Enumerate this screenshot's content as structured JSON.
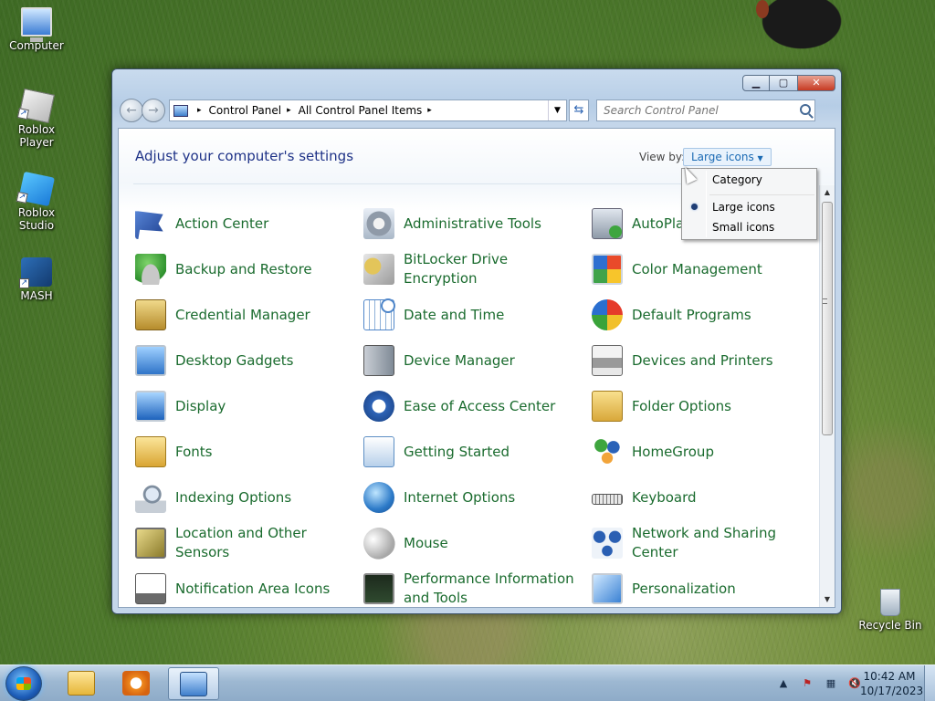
{
  "desktop": {
    "icons": [
      {
        "label": "Computer",
        "icon": "computer-icon"
      },
      {
        "label": "Roblox Player",
        "icon": "roblox-player-icon"
      },
      {
        "label": "Roblox Studio",
        "icon": "roblox-studio-icon"
      },
      {
        "label": "MASH",
        "icon": "mash-icon"
      },
      {
        "label": "Recycle Bin",
        "icon": "recycle-bin-icon"
      }
    ]
  },
  "window": {
    "address": {
      "segments": [
        "Control Panel",
        "All Control Panel Items"
      ],
      "separator": "▸"
    },
    "search_placeholder": "Search Control Panel",
    "heading": "Adjust your computer's settings",
    "view_by_label": "View by:",
    "view_by_value": "Large icons",
    "view_menu": {
      "items": [
        "Category",
        "Large icons",
        "Small icons"
      ],
      "selected": "Large icons"
    },
    "items": [
      {
        "label": "Action Center",
        "icon": "flag-icon",
        "color": "#2b58b3"
      },
      {
        "label": "Administrative Tools",
        "icon": "admin-tools-icon",
        "color": "#7f8a99"
      },
      {
        "label": "AutoPlay",
        "icon": "autoplay-icon",
        "color": "#4a8f3a"
      },
      {
        "label": "Backup and Restore",
        "icon": "backup-icon",
        "color": "#3aa23a"
      },
      {
        "label": "BitLocker Drive Encryption",
        "icon": "bitlocker-icon",
        "color": "#9c9c9c"
      },
      {
        "label": "Color Management",
        "icon": "color-management-icon",
        "color": "#d9452a"
      },
      {
        "label": "Credential Manager",
        "icon": "credential-icon",
        "color": "#c9a646"
      },
      {
        "label": "Date and Time",
        "icon": "calendar-clock-icon",
        "color": "#4f86c9"
      },
      {
        "label": "Default Programs",
        "icon": "default-programs-icon",
        "color": "#d93a2a"
      },
      {
        "label": "Desktop Gadgets",
        "icon": "gadgets-icon",
        "color": "#3c7fd1"
      },
      {
        "label": "Device Manager",
        "icon": "device-manager-icon",
        "color": "#8a96a3"
      },
      {
        "label": "Devices and Printers",
        "icon": "printer-icon",
        "color": "#8c8c8c"
      },
      {
        "label": "Display",
        "icon": "display-icon",
        "color": "#2f78d0"
      },
      {
        "label": "Ease of Access Center",
        "icon": "ease-of-access-icon",
        "color": "#1f4f9c"
      },
      {
        "label": "Folder Options",
        "icon": "folder-options-icon",
        "color": "#e3bd4a"
      },
      {
        "label": "Fonts",
        "icon": "fonts-icon",
        "color": "#e6b83c"
      },
      {
        "label": "Getting Started",
        "icon": "getting-started-icon",
        "color": "#5d8fc4"
      },
      {
        "label": "HomeGroup",
        "icon": "homegroup-icon",
        "color": "#2a62b8"
      },
      {
        "label": "Indexing Options",
        "icon": "indexing-icon",
        "color": "#8c9aa8"
      },
      {
        "label": "Internet Options",
        "icon": "internet-options-icon",
        "color": "#2f7fc9"
      },
      {
        "label": "Keyboard",
        "icon": "keyboard-icon",
        "color": "#8d8d8d"
      },
      {
        "label": "Location and Other Sensors",
        "icon": "location-icon",
        "color": "#b9a44a"
      },
      {
        "label": "Mouse",
        "icon": "mouse-icon",
        "color": "#a8a8a8"
      },
      {
        "label": "Network and Sharing Center",
        "icon": "network-icon",
        "color": "#2a5fb3"
      },
      {
        "label": "Notification Area Icons",
        "icon": "notification-icon",
        "color": "#6a6a6a"
      },
      {
        "label": "Performance Information and Tools",
        "icon": "performance-icon",
        "color": "#3a7a3a"
      },
      {
        "label": "Personalization",
        "icon": "personalization-icon",
        "color": "#3b82d4"
      }
    ]
  },
  "taskbar": {
    "buttons": [
      {
        "name": "windows-explorer",
        "icon": "folder-icon"
      },
      {
        "name": "windows-media-player",
        "icon": "media-player-icon"
      },
      {
        "name": "control-panel",
        "icon": "control-panel-icon",
        "active": true
      }
    ],
    "tray_icons": [
      "show-hidden-icons-arrow",
      "action-center-flag-icon",
      "network-icon",
      "volume-muted-icon"
    ],
    "tray_glyphs": [
      "▲",
      "⚑",
      "▦",
      "🔇"
    ],
    "time": "10:42 AM",
    "date": "10/17/2023"
  }
}
